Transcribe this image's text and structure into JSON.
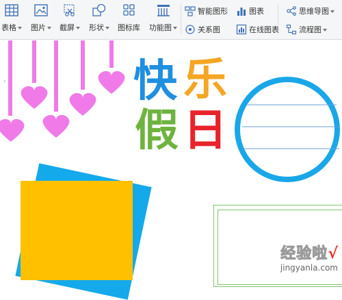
{
  "toolbar": {
    "table_label": "表格",
    "picture_label": "图片",
    "screenshot_label": "截屏",
    "shape_label": "形状",
    "iconlib_label": "图标库",
    "funcchart_label": "功能图",
    "smartart_label": "智能图形",
    "chart_label": "图表",
    "mindmap_label": "思维导图",
    "relation_label": "关系图",
    "onlinechart_label": "在线图表",
    "flowchart_label": "流程图"
  },
  "document": {
    "chars": {
      "c1": "快",
      "c2": "乐",
      "c3": "假",
      "c4": "日"
    },
    "colors": {
      "heart": "#f07ae8",
      "orange_square": "#ffc000",
      "blue_square": "#14a9ea",
      "circle_stroke": "#1aa7e8",
      "char1": "#1f8fe0",
      "char2": "#f5a623",
      "char3": "#6fb33f",
      "char4": "#e8232a"
    }
  },
  "watermark": {
    "main": "经验啦",
    "check": "√",
    "url": "jingyanla.com"
  }
}
